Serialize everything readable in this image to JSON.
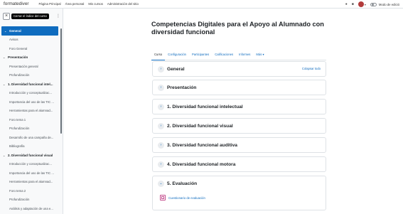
{
  "navbar": {
    "brand": "formatediver",
    "items": [
      "Página Principal",
      "Área personal",
      "Mis cursos",
      "Administración del sitio"
    ],
    "icons": [
      "bell-icon",
      "chat-icon",
      "user-avatar"
    ],
    "edit_mode_label": "Modo de edició"
  },
  "drawer": {
    "close_label": "×",
    "tooltip": "Cerrar el índice del curso",
    "menu_icon": "⋮",
    "items": [
      {
        "type": "section",
        "label": "General",
        "active": true
      },
      {
        "type": "item",
        "label": "Avisos"
      },
      {
        "type": "item",
        "label": "Foro General"
      },
      {
        "type": "section",
        "label": "Presentación"
      },
      {
        "type": "item",
        "label": "Presentación general"
      },
      {
        "type": "item",
        "label": "Profundización"
      },
      {
        "type": "section",
        "label": "1. Diversidad funcional intel..."
      },
      {
        "type": "item",
        "label": "Introducción y conceptualizac..."
      },
      {
        "type": "item",
        "label": "Importancia del uso de las TIC ..."
      },
      {
        "type": "item",
        "label": "Herramientas para el alumnad..."
      },
      {
        "type": "item",
        "label": "Foro tema 1"
      },
      {
        "type": "item",
        "label": "Profundización"
      },
      {
        "type": "item",
        "label": "Desarrollo de una campaña de..."
      },
      {
        "type": "item",
        "label": "Bibliografía"
      },
      {
        "type": "section",
        "label": "2. Diversidad funcional visual"
      },
      {
        "type": "item",
        "label": "Introducción y conceptualizac..."
      },
      {
        "type": "item",
        "label": "Importancia del uso de las TIC ..."
      },
      {
        "type": "item",
        "label": "Herramientas para el alumnad..."
      },
      {
        "type": "item",
        "label": "Foro tema 2"
      },
      {
        "type": "item",
        "label": "Profundización"
      },
      {
        "type": "item",
        "label": "Análisis y adaptación de una e..."
      }
    ]
  },
  "course": {
    "title": "Competencias Digitales para el Apoyo al Alumnado con diversidad funcional",
    "tabs": [
      {
        "label": "Curso",
        "active": true
      },
      {
        "label": "Configuración"
      },
      {
        "label": "Participantes"
      },
      {
        "label": "Calificaciones"
      },
      {
        "label": "Informes"
      },
      {
        "label": "Más ▾"
      }
    ],
    "collapse_all": "Colapsar todo",
    "sections": [
      {
        "title": "General",
        "chevron": "›"
      },
      {
        "title": "Presentación",
        "chevron": "›"
      },
      {
        "title": "1. Diversidad funcional intelectual",
        "chevron": "›"
      },
      {
        "title": "2. Diversidad funcional visual",
        "chevron": "›"
      },
      {
        "title": "3. Diversidad funcional auditiva",
        "chevron": "›"
      },
      {
        "title": "4. Diversidad funcional motora",
        "chevron": "›"
      },
      {
        "title": "5. Evaluación",
        "chevron": "⌄",
        "activity": "Cuestionario de evaluación"
      }
    ]
  }
}
